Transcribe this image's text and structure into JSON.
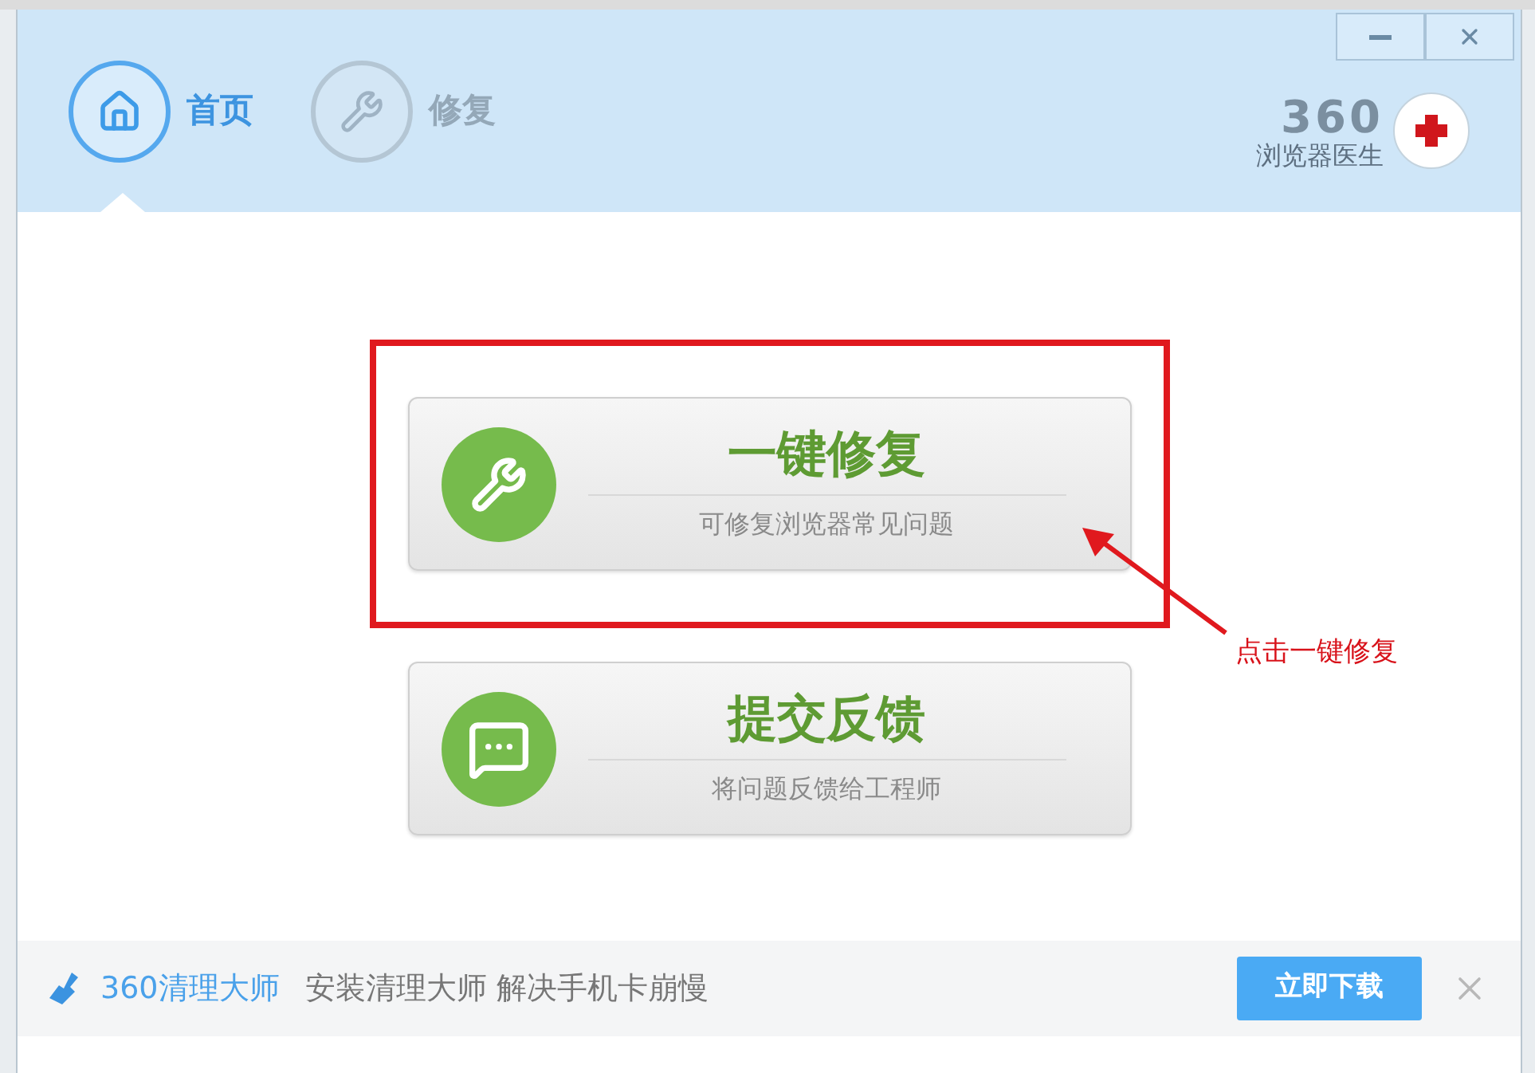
{
  "window": {
    "controls": [
      {
        "kind": "minimize"
      },
      {
        "kind": "close"
      }
    ]
  },
  "nav": [
    {
      "kind": "home",
      "label": "首页",
      "selected": true
    },
    {
      "kind": "repair",
      "label": "修复",
      "selected": false
    }
  ],
  "brand": {
    "number": "360",
    "name": "浏览器医生"
  },
  "actions": [
    {
      "kind": "repair",
      "title": "一键修复",
      "subtitle": "可修复浏览器常见问题",
      "highlighted": true
    },
    {
      "kind": "feedback",
      "title": "提交反馈",
      "subtitle": "将问题反馈给工程师",
      "highlighted": false
    }
  ],
  "annotation": {
    "text": "点击一键修复"
  },
  "banner": {
    "brand": "360清理大师",
    "text": "安装清理大师 解决手机卡崩慢",
    "button": "立即下载"
  }
}
